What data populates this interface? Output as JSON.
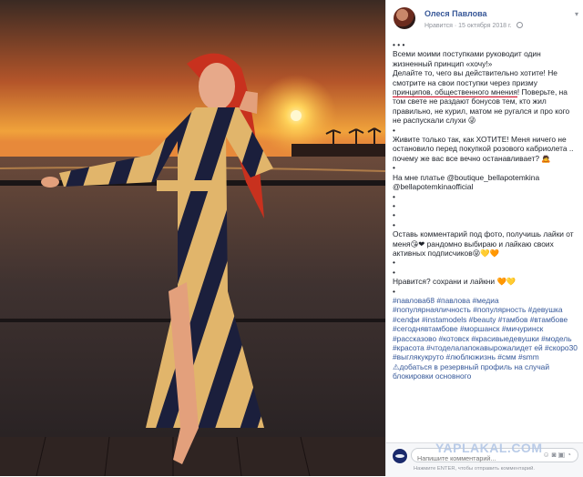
{
  "photo": {
    "description_icon": "photo-image",
    "colors": {
      "sky_top": "#3b2a22",
      "sun": "#ffe27a",
      "horizon": "#f0a23b",
      "sea": "#2f2a2a",
      "hair": "#c8311e",
      "dress_light": "#e1b56b",
      "dress_dark": "#1b1f3c"
    }
  },
  "post": {
    "author": "Олеся Павлова",
    "like_label": "Нравится",
    "date": "15 октября 2018 г.",
    "paragraphs": [
      "• • •",
      "Всеми моими поступками руководит один жизненный принцип «хочу!»",
      "Делайте то, чего вы действительно хотите! Не смотрите на свои поступки через призму",
      "принципов, общественного мнения",
      "! Поверьте, на том свете не раздают бонусов тем, кто жил правильно, не курил, матом не ругался и про кого не распускали слухи 😜",
      "•",
      "Живите только так, как ХОТИТЕ! Меня ничего не остановило перед покупкой розового кабриолета .. почему же вас все вечно останавливает? 🙇",
      "•",
      "На мне платье @boutique_bellapotemkina @bellapotemkinaofficial",
      "•\n•\n•\n•",
      "Оставь комментарий под фото, получишь лайки от меня😘❤ рандомно выбираю и лайкаю своих активных подписчиков😝💛🧡",
      "•\n•",
      "Нравится? сохрани и лайкни 🧡💛",
      "•"
    ],
    "hashtags": "#павлова68 #павлова #медиа #популярнаяличность #популярность #девушка #селфи #instamodels #beauty #тамбов #втамбове #сегоднявтамбове #моршанск #мичуринск #рассказово #котовск #красивыедевушки #модель #красота #чтоделалапокавырожалидет ей #скоро30 #выглякукруто #люблюжизнь #смм #smm ⚠добаться в резервный профиль на случай блокировки основного"
  },
  "footer": {
    "comment_placeholder": "Напишите комментарий...",
    "icons": [
      "emoji-icon",
      "camera-icon",
      "gif-icon",
      "sticker-icon"
    ],
    "hint": "Нажмите ENTER, чтобы отправить комментарий."
  },
  "watermark": "YAPLAKAL.COM"
}
